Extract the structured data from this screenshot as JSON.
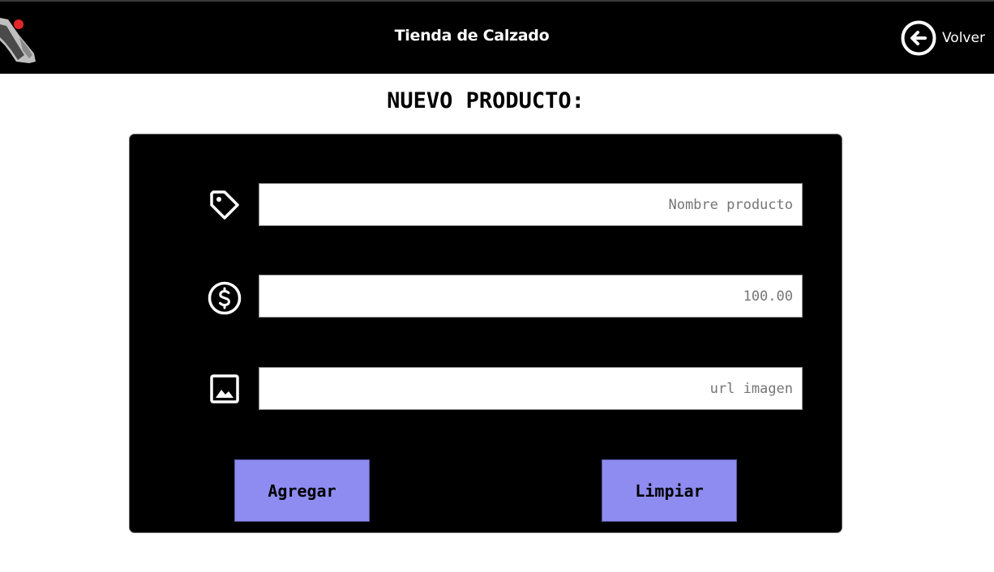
{
  "header": {
    "title": "Tienda de Calzado",
    "back_label": "Volver",
    "back_icon": "arrow-left-circle-icon",
    "logo_icon": "shoe-logo-icon"
  },
  "page": {
    "title": "NUEVO PRODUCTO:"
  },
  "form": {
    "fields": [
      {
        "icon": "tag-icon",
        "value": "",
        "placeholder": "Nombre producto"
      },
      {
        "icon": "dollar-circle-icon",
        "value": "",
        "placeholder": "100.00"
      },
      {
        "icon": "image-icon",
        "value": "",
        "placeholder": "url imagen"
      }
    ],
    "add_label": "Agregar",
    "clear_label": "Limpiar"
  },
  "colors": {
    "header_bg": "#000000",
    "panel_bg": "#000000",
    "button_bg": "#8e8cf0",
    "logo_accent": "#e3262b"
  }
}
